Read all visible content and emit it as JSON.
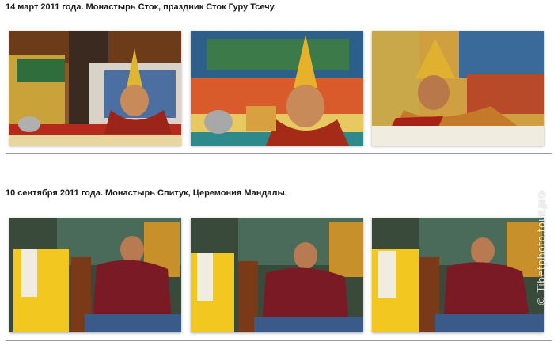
{
  "section1": {
    "caption": "14 март 2011 года. Монастырь Сток, праздник Сток Гуру Тсечу.",
    "photos": [
      {
        "icon": "child-lama-yellow-hat-photo"
      },
      {
        "icon": "child-lama-yellow-hat-photo"
      },
      {
        "icon": "child-lama-yellow-hat-photo"
      }
    ]
  },
  "section2": {
    "caption": "10 сентября 2011 года. Монастырь Спитук, Церемония Мандалы.",
    "photos": [
      {
        "icon": "child-monk-red-robe-photo"
      },
      {
        "icon": "child-monk-red-robe-photo"
      },
      {
        "icon": "child-monk-red-robe-photo"
      }
    ]
  },
  "watermark": "© Tibetphoto.tour.pro",
  "colors": {
    "caption": "#1a1a1a",
    "divider": "#9a9a9a",
    "background": "#ffffff"
  }
}
